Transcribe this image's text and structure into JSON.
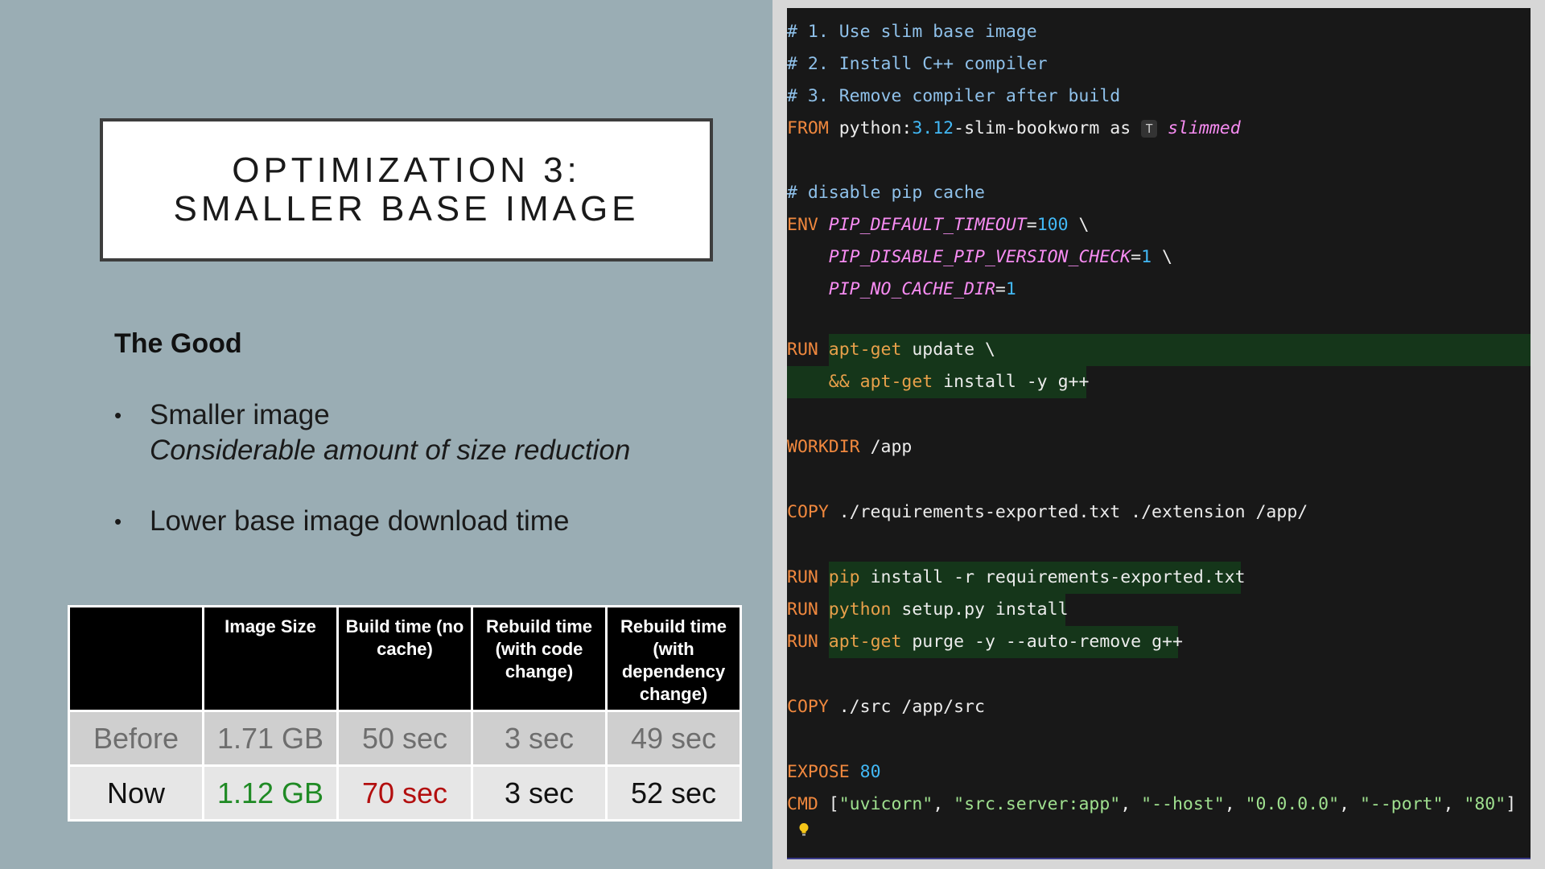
{
  "slide": {
    "title_line1": "OPTIMIZATION 3:",
    "title_line2": "SMALLER BASE IMAGE",
    "section_heading": "The Good",
    "bullets": [
      {
        "text": "Smaller image",
        "sub": "Considerable amount of size reduction"
      },
      {
        "text": "Lower base image download time",
        "sub": ""
      }
    ],
    "bullet_char": "•"
  },
  "table": {
    "headers": [
      "",
      "Image Size",
      "Build time (no cache)",
      "Rebuild time (with code change)",
      "Rebuild time (with dependency change)"
    ],
    "rows": [
      {
        "label": "Before",
        "values": [
          "1.71 GB",
          "50 sec",
          "3 sec",
          "49 sec"
        ]
      },
      {
        "label": "Now",
        "values": [
          "1.12 GB",
          "70 sec",
          "3 sec",
          "52 sec"
        ]
      }
    ],
    "colors": {
      "improved": "#1f8a24",
      "worse": "#b30f0f"
    }
  },
  "code": {
    "l1": "# 1. Use slim base image",
    "l2": "# 2. Install C++ compiler",
    "l3": "# 3. Remove compiler after build",
    "from_kw": "FROM",
    "from_img": " python:",
    "from_ver": "3.12",
    "from_rest": "-slim-bookworm as ",
    "from_badge": "T",
    "from_alias": "slimmed",
    "c_pip": "# disable pip cache",
    "env_kw": "ENV",
    "env1_var": "PIP_DEFAULT_TIMEOUT",
    "env1_val": "100",
    "env2_var": "PIP_DISABLE_PIP_VERSION_CHECK",
    "env2_val": "1",
    "env3_var": "PIP_NO_CACHE_DIR",
    "env3_val": "1",
    "eq": "=",
    "cont": " \\",
    "run_kw": "RUN",
    "apt": "apt-get",
    "update": " update \\",
    "and": "&&",
    "install_gpp": " install -y g++",
    "workdir_kw": "WORKDIR",
    "workdir_path": "/app",
    "copy_kw": "COPY",
    "copy1": " ./requirements-exported.txt ./extension /app/",
    "pip": "pip",
    "pip_args": " install -r requirements-exported.txt",
    "python": "python",
    "python_args": " setup.py install",
    "purge": " purge -y --auto-remove g++",
    "copy2": " ./src /app/src",
    "expose_kw": "EXPOSE",
    "expose_port": "80",
    "cmd_kw": "CMD",
    "cmd_open": " [",
    "cmd_args": [
      "\"uvicorn\"",
      "\"src.server:app\"",
      "\"--host\"",
      "\"0.0.0.0\"",
      "\"--port\"",
      "\"80\""
    ],
    "cmd_sep": ", ",
    "cmd_close": "]"
  },
  "colors": {
    "background": "#9aadb4",
    "editor_bg": "#181818",
    "highlight": "#15361a"
  },
  "icons": {
    "alias_badge": "type-badge-icon",
    "hint": "lightbulb-icon"
  }
}
